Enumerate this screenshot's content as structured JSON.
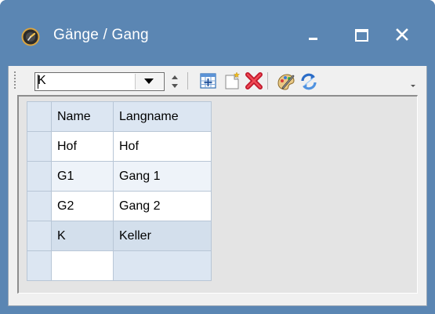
{
  "window": {
    "title": "Gänge / Gang",
    "titlebar_color": "#5b86b3"
  },
  "toolbar": {
    "combo_value": "K",
    "icons": [
      "spinner-icon",
      "column-chooser-icon",
      "new-record-icon",
      "delete-icon",
      "edit-icon",
      "refresh-icon",
      "overflow-icon"
    ]
  },
  "grid": {
    "columns": [
      "Name",
      "Langname"
    ],
    "rows": [
      {
        "name": "Hof",
        "langname": "Hof"
      },
      {
        "name": "G1",
        "langname": "Gang 1"
      },
      {
        "name": "G2",
        "langname": "Gang 2"
      },
      {
        "name": "K",
        "langname": "Keller"
      }
    ],
    "selected_row": 3
  }
}
